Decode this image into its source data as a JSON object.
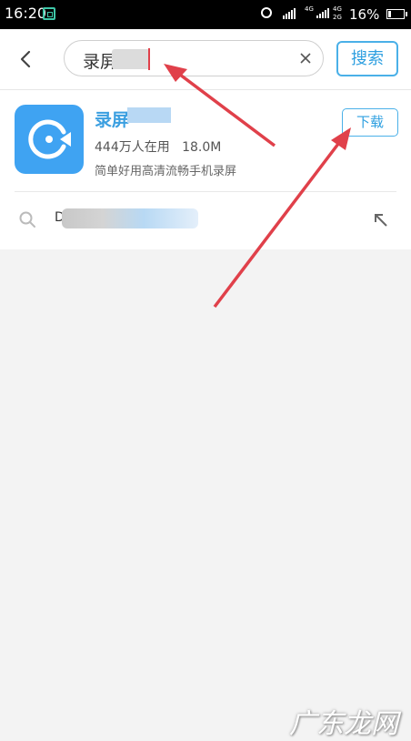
{
  "status_bar": {
    "time": "16:20",
    "battery_percent": "16%",
    "network_labels": [
      "4G",
      "4G",
      "2G"
    ],
    "screenshot_icon": "screenshot-icon",
    "alarm_icon": "alarm-icon",
    "battery_level": 0.16
  },
  "header": {
    "back_icon": "chevron-left-icon",
    "search_value": "录屏",
    "clear_icon": "close-icon",
    "search_button_label": "搜索"
  },
  "result": {
    "app_name": "录屏",
    "stats": "444万人在用   18.0M",
    "description": "简单好用高清流畅手机录屏",
    "download_label": "下载",
    "icon": "video-camera-icon"
  },
  "suggestion": {
    "text_prefix": "D",
    "fill_icon": "arrow-up-left-icon"
  },
  "watermark": "广东龙网",
  "colors": {
    "accent": "#2d9fe0",
    "app_icon_bg": "#3fa3f2",
    "annotation_arrow": "#e0404a",
    "page_bg": "#f3f3f3"
  }
}
